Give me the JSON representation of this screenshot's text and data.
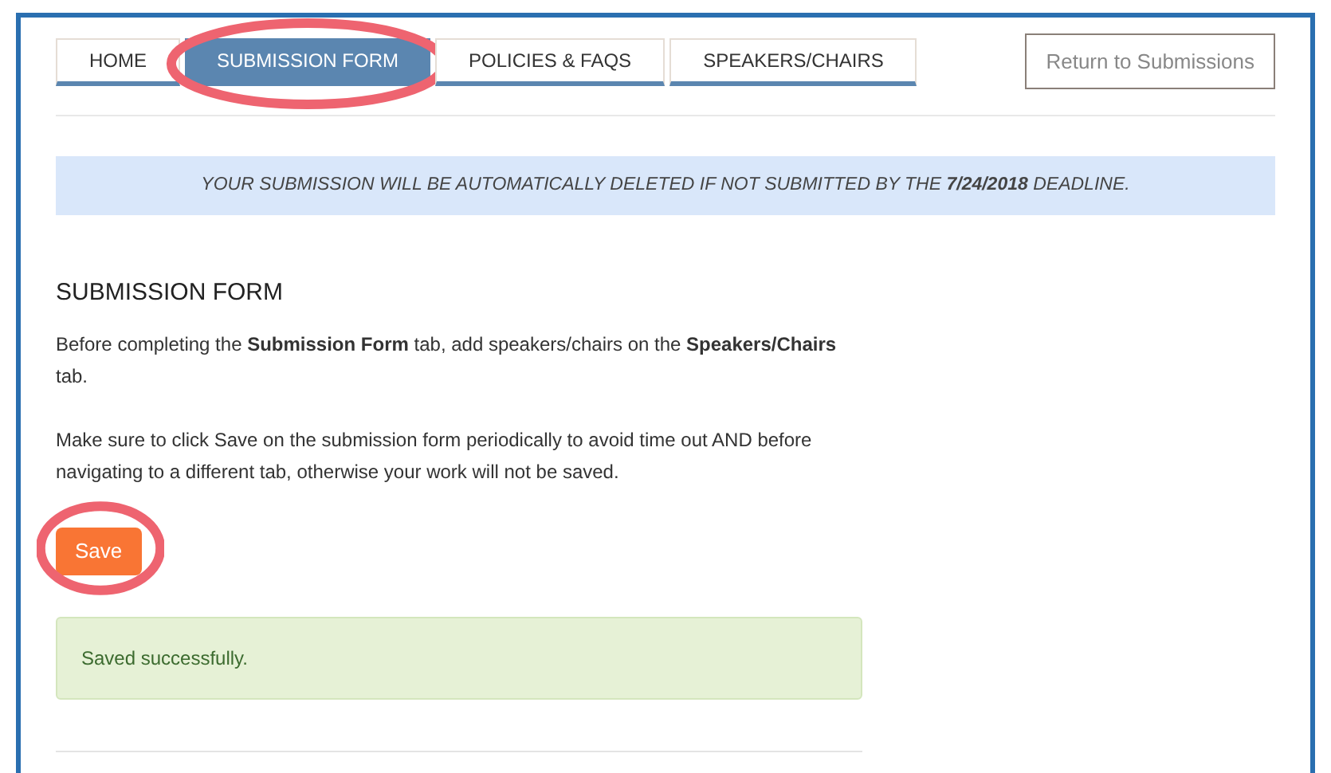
{
  "tabs": [
    {
      "label": "HOME",
      "selected": false,
      "highlighted": false
    },
    {
      "label": "SUBMISSION FORM",
      "selected": true,
      "highlighted": true
    },
    {
      "label": "POLICIES & FAQS",
      "selected": false,
      "highlighted": false
    },
    {
      "label": "SPEAKERS/CHAIRS",
      "selected": false,
      "highlighted": false
    }
  ],
  "return_button": "Return to Submissions",
  "banner": "YOUR SUBMISSION WILL BE AUTOMATICALLY DELETED IF NOT SUBMITTED BY THE **7/24/2018** DEADLINE.",
  "heading": "SUBMISSION FORM",
  "paragraphs": [
    "Before completing the **Submission Form** tab, add speakers/chairs on the **Speakers/Chairs** tab.",
    "Make sure to click Save on the submission form periodically to avoid time out AND before navigating to a different tab, otherwise your work will not be saved."
  ],
  "save_button": {
    "label": "Save",
    "highlighted": true
  },
  "success_message": "Saved successfully."
}
